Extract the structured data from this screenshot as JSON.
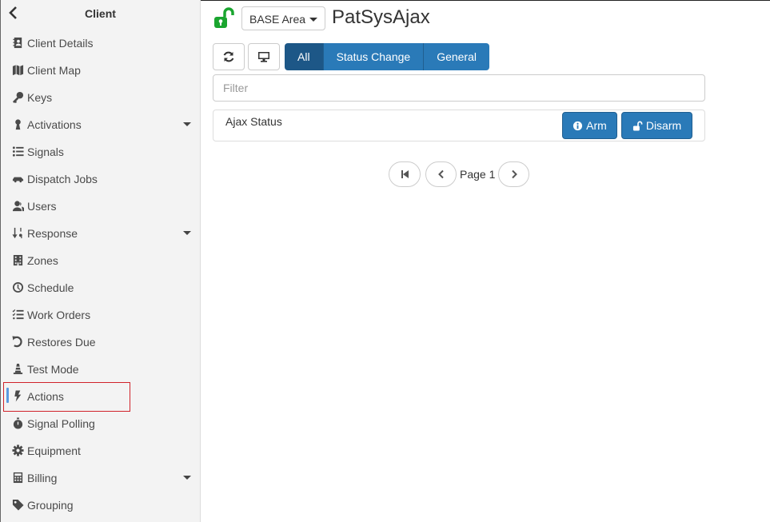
{
  "sidebar": {
    "title": "Client",
    "back_icon": "chevron-left-icon",
    "items": [
      {
        "label": "Client Details",
        "icon": "address-book-icon",
        "expandable": false,
        "active": false
      },
      {
        "label": "Client Map",
        "icon": "map-icon",
        "expandable": false,
        "active": false
      },
      {
        "label": "Keys",
        "icon": "key-icon",
        "expandable": false,
        "active": false
      },
      {
        "label": "Activations",
        "icon": "antenna-icon",
        "expandable": true,
        "active": false
      },
      {
        "label": "Signals",
        "icon": "list-icon",
        "expandable": false,
        "active": false
      },
      {
        "label": "Dispatch Jobs",
        "icon": "car-icon",
        "expandable": false,
        "active": false
      },
      {
        "label": "Users",
        "icon": "users-icon",
        "expandable": false,
        "active": false
      },
      {
        "label": "Response",
        "icon": "sort-numeric-icon",
        "expandable": true,
        "active": false
      },
      {
        "label": "Zones",
        "icon": "building-icon",
        "expandable": false,
        "active": false
      },
      {
        "label": "Schedule",
        "icon": "clock-icon",
        "expandable": false,
        "active": false
      },
      {
        "label": "Work Orders",
        "icon": "tasks-icon",
        "expandable": false,
        "active": false
      },
      {
        "label": "Restores Due",
        "icon": "undo-icon",
        "expandable": false,
        "active": false
      },
      {
        "label": "Test Mode",
        "icon": "cone-icon",
        "expandable": false,
        "active": false
      },
      {
        "label": "Actions",
        "icon": "bolt-icon",
        "expandable": false,
        "active": true
      },
      {
        "label": "Signal Polling",
        "icon": "stopwatch-icon",
        "expandable": false,
        "active": false
      },
      {
        "label": "Equipment",
        "icon": "cog-icon",
        "expandable": false,
        "active": false
      },
      {
        "label": "Billing",
        "icon": "calculator-icon",
        "expandable": true,
        "active": false
      },
      {
        "label": "Grouping",
        "icon": "tag-icon",
        "expandable": false,
        "active": false
      }
    ]
  },
  "header": {
    "lock_icon": "unlocked-icon",
    "lock_color": "#1aa52f",
    "area_select": "BASE Area",
    "title": "PatSysAjax"
  },
  "toolbar": {
    "refresh_icon": "refresh-icon",
    "monitor_icon": "desktop-icon",
    "tabs": [
      {
        "label": "All",
        "selected": true
      },
      {
        "label": "Status Change",
        "selected": false
      },
      {
        "label": "General",
        "selected": false
      }
    ],
    "accent": "#2a7ab8"
  },
  "filter": {
    "placeholder": "Filter",
    "value": ""
  },
  "actions": [
    {
      "name": "Ajax Status",
      "buttons": [
        {
          "label": "Arm",
          "icon": "info-circle-icon"
        },
        {
          "label": "Disarm",
          "icon": "unlock-icon"
        }
      ]
    }
  ],
  "pager": {
    "label": "Page 1"
  },
  "highlight_color": "#d0232a"
}
